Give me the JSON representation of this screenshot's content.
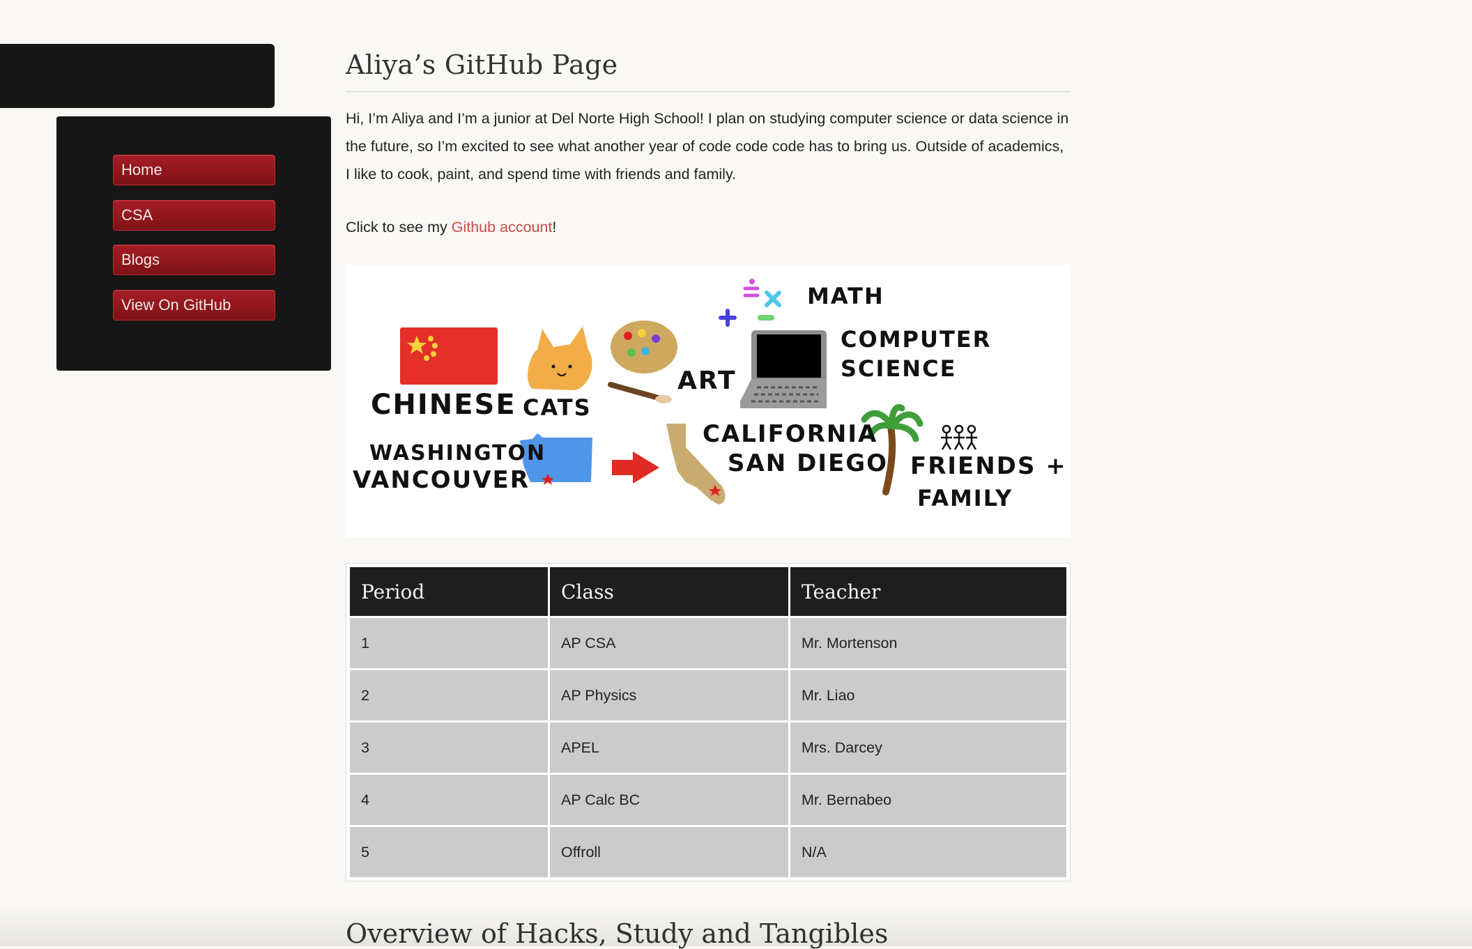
{
  "sidebar": {
    "items": [
      {
        "label": "Home"
      },
      {
        "label": "CSA"
      },
      {
        "label": "Blogs"
      },
      {
        "label": "View On GitHub"
      }
    ]
  },
  "page": {
    "title": "Aliya’s GitHub Page",
    "intro": "Hi, I’m Aliya and I’m a junior at Del Norte High School! I plan on studying computer science or data science in the future, so I’m excited to see what another year of code code code has to bring us. Outside of academics, I like to cook, paint, and spend time with friends and family.",
    "github_prefix": "Click to see my ",
    "github_link": "Github account",
    "github_suffix": "!"
  },
  "interests_image": {
    "labels": {
      "chinese": "CHINESE",
      "cats": "CATS",
      "art": "ART",
      "math": "MATH",
      "cs1": "COMPUTER",
      "cs2": "SCIENCE",
      "wa1": "WASHINGTON",
      "wa2": "VANCOUVER",
      "ca1": "CALIFORNIA",
      "ca2": "SAN DIEGO",
      "ff1": "FRIENDS +",
      "ff2": "FAMILY"
    }
  },
  "schedule": {
    "headers": [
      "Period",
      "Class",
      "Teacher"
    ],
    "rows": [
      [
        "1",
        "AP CSA",
        "Mr. Mortenson"
      ],
      [
        "2",
        "AP Physics",
        "Mr. Liao"
      ],
      [
        "3",
        "APEL",
        "Mrs. Darcey"
      ],
      [
        "4",
        "AP Calc BC",
        "Mr. Bernabeo"
      ],
      [
        "5",
        "Offroll",
        "N/A"
      ]
    ]
  },
  "next_section": {
    "heading": "Overview of Hacks, Study and Tangibles"
  },
  "colors": {
    "background": "#f9f8f5",
    "sidebar": "#161616",
    "nav_button": "#a51d24",
    "link": "#cc4a4a",
    "table_header": "#1e1e1e",
    "table_cell": "#cbcbcb"
  }
}
